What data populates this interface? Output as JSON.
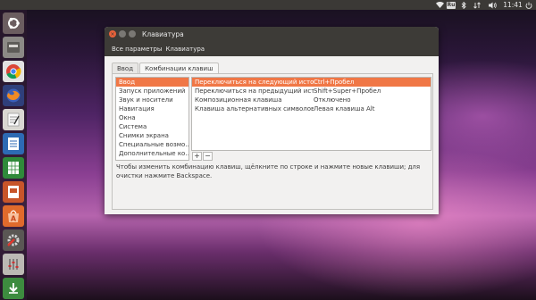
{
  "panel": {
    "keyboard_indicator": "Ru",
    "time": "11:41"
  },
  "launcher": {
    "items": [
      {
        "name": "ubuntu-dash-icon"
      },
      {
        "name": "files-icon"
      },
      {
        "name": "chrome-icon"
      },
      {
        "name": "firefox-icon"
      },
      {
        "name": "text-editor-icon"
      },
      {
        "name": "writer-icon"
      },
      {
        "name": "calc-icon"
      },
      {
        "name": "impress-icon"
      },
      {
        "name": "software-center-icon"
      },
      {
        "name": "system-settings-icon"
      },
      {
        "name": "mixer-icon"
      },
      {
        "name": "download-icon"
      }
    ]
  },
  "window": {
    "title": "Клавиатура",
    "toolbar": {
      "all_settings": "Все параметры",
      "current": "Клавиатура"
    },
    "tabs": [
      "Ввод",
      "Комбинации клавиш"
    ],
    "categories": [
      "Ввод",
      "Запуск приложений",
      "Звук и носители",
      "Навигация",
      "Окна",
      "Система",
      "Снимки экрана",
      "Специальные возмо…",
      "Дополнительные ко…"
    ],
    "shortcuts": [
      {
        "action": "Переключиться на следующий источник",
        "keys": "Ctrl+Пробел"
      },
      {
        "action": "Переключиться на предыдущий источник",
        "keys": "Shift+Super+Пробел"
      },
      {
        "action": "Композиционная клавиша",
        "keys": "Отключено"
      },
      {
        "action": "Клавиша альтернативных символов",
        "keys": "Левая клавиша Alt"
      }
    ],
    "add_label": "+",
    "remove_label": "−",
    "hint": "Чтобы изменить комбинацию клавиш, щёлкните по строке и нажмите новые клавиши; для очистки нажмите Backspace."
  },
  "colors": {
    "accent": "#f07746",
    "titlebar": "#3d3b37",
    "panel": "#3b3936"
  }
}
